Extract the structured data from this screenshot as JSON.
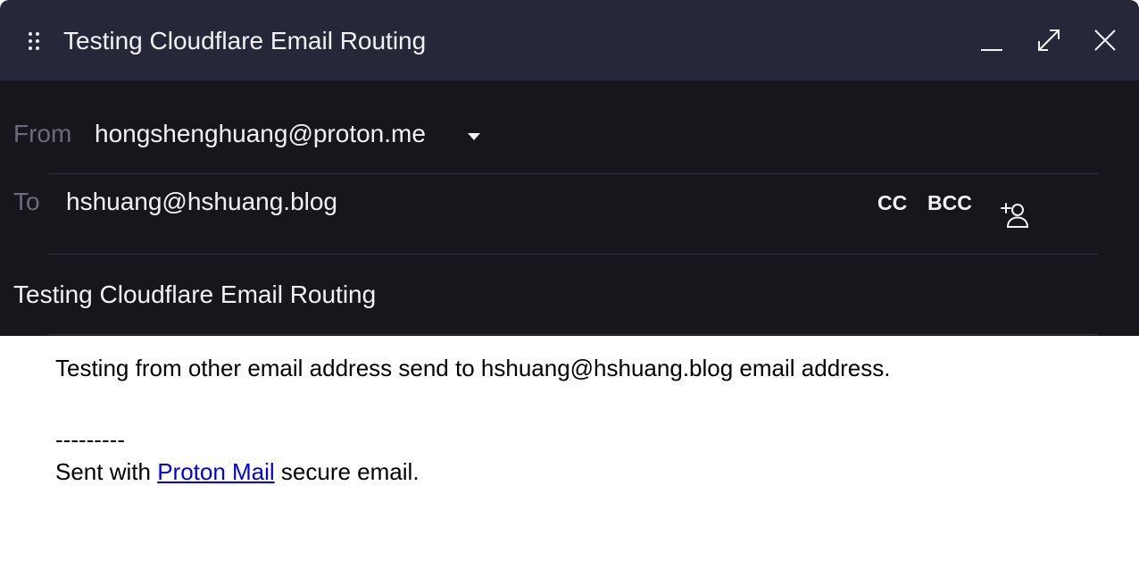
{
  "window": {
    "title": "Testing Cloudflare Email Routing",
    "controls": [
      "minimize-icon",
      "maximize-icon",
      "close-icon"
    ]
  },
  "from": {
    "label": "From",
    "address": "hongshenghuang@proton.me"
  },
  "to": {
    "label": "To",
    "address": "hshuang@hshuang.blog",
    "cc_label": "CC",
    "bcc_label": "BCC"
  },
  "subject": {
    "value": "Testing Cloudflare Email Routing"
  },
  "body": {
    "text": "Testing from other email address send to hshuang@hshuang.blog email address.",
    "signature_separator": "---------",
    "signature_prefix": "Sent with",
    "signature_link": "Proton Mail",
    "signature_suffix": "secure email."
  },
  "colors": {
    "titlebar_bg": "#262839",
    "header_bg": "#17161d",
    "label": "#6c6b7b",
    "text": "#f2f2f6",
    "link": "#0000ee"
  }
}
